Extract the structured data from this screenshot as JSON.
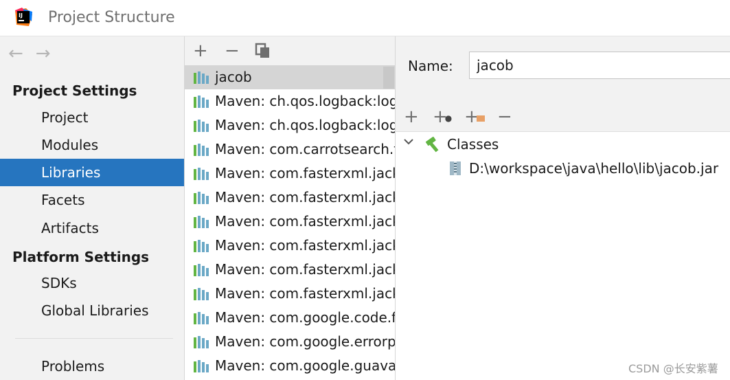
{
  "window": {
    "title": "Project Structure"
  },
  "sidebar": {
    "sections": [
      {
        "label": "Project Settings",
        "items": [
          "Project",
          "Modules",
          "Libraries",
          "Facets",
          "Artifacts"
        ]
      },
      {
        "label": "Platform Settings",
        "items": [
          "SDKs",
          "Global Libraries"
        ]
      }
    ],
    "active_item": "Libraries",
    "problems_label": "Problems"
  },
  "libraries": {
    "toolbar": {
      "add": "+",
      "remove": "−",
      "copy": "copy"
    },
    "items": [
      "jacob",
      "Maven: ch.qos.logback:logback-classic",
      "Maven: ch.qos.logback:logback-core",
      "Maven: com.carrotsearch.thirdparty",
      "Maven: com.fasterxml.jackson",
      "Maven: com.fasterxml.jackson",
      "Maven: com.fasterxml.jackson",
      "Maven: com.fasterxml.jackson",
      "Maven: com.fasterxml.jackson",
      "Maven: com.fasterxml.jackson",
      "Maven: com.google.code.findbugs",
      "Maven: com.google.errorprone",
      "Maven: com.google.guava"
    ],
    "selected": "jacob"
  },
  "detail": {
    "name_label": "Name:",
    "name_value": "jacob",
    "toolbar": {
      "add": "+",
      "add_url": "+",
      "add_folder": "+",
      "remove": "−"
    },
    "tree": {
      "root_label": "Classes",
      "children": [
        "D:\\workspace\\java\\hello\\lib\\jacob.jar"
      ]
    }
  },
  "watermark": "CSDN @长安紫薯",
  "colors": {
    "accent": "#2675bf",
    "selection": "#d5d5d5",
    "panel": "#f2f2f2"
  }
}
